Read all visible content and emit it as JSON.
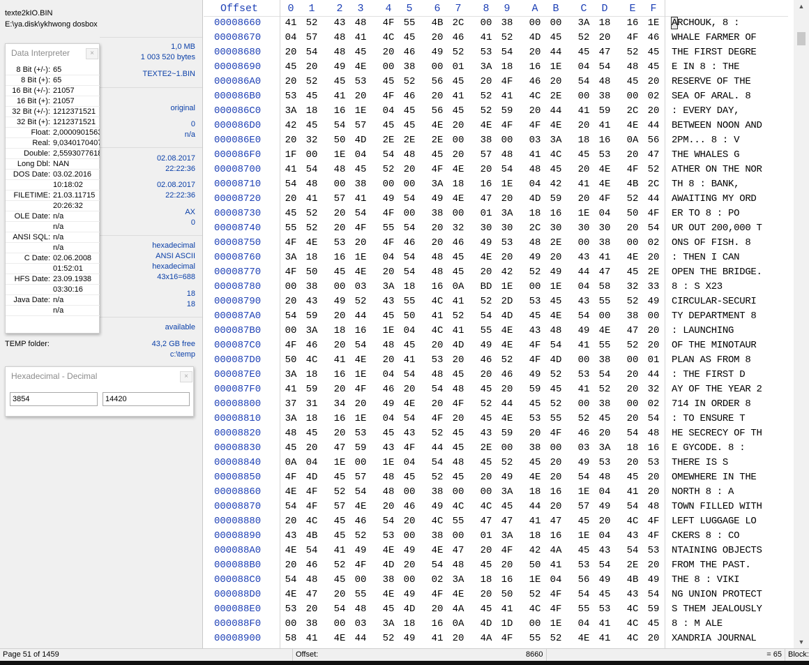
{
  "left_panel": {
    "file_name": "texte2kIO.BIN",
    "file_path": "E:\\ya.disk\\ykhwong dosbox",
    "file_size": "1,0 MB",
    "file_bytes": "1 003 520 bytes",
    "short_name": "TEXTE2~1.BIN",
    "mode": "original",
    "val_zero": "0",
    "val_na": "n/a",
    "created_date": "02.08.2017",
    "created_time": "22:22:36",
    "modified_date": "02.08.2017",
    "modified_time": "22:22:36",
    "attributes": "AX",
    "attr_zero": "0",
    "offset_base": "hexadecimal",
    "charset": "ANSI ASCII",
    "offset_mode": "hexadecimal",
    "bytes_per_row": "43x16=688",
    "val_18a": "18",
    "val_18b": "18",
    "undo": "available",
    "temp_label": "TEMP folder:",
    "temp_free": "43,2 GB free",
    "temp_path": "c:\\temp"
  },
  "data_interpreter": {
    "title": "Data Interpreter",
    "close": "×",
    "rows": [
      {
        "label": "8 Bit (+/-):",
        "value": "65"
      },
      {
        "label": "8 Bit (+):",
        "value": "65"
      },
      {
        "label": "16 Bit (+/-):",
        "value": "21057"
      },
      {
        "label": "16 Bit (+):",
        "value": "21057"
      },
      {
        "label": "32 Bit (+/-):",
        "value": "1212371521"
      },
      {
        "label": "32 Bit (+):",
        "value": "1212371521"
      },
      {
        "label": "Float:",
        "value": "2,0000901563"
      },
      {
        "label": "Real:",
        "value": "9,0340170407"
      },
      {
        "label": "Double:",
        "value": "2,5593077618"
      },
      {
        "label": "Long Dbl:",
        "value": "NAN"
      },
      {
        "label": "DOS Date:",
        "value": "03.02.2016"
      },
      {
        "label": "",
        "value": "10:18:02"
      },
      {
        "label": "FILETIME:",
        "value": "21.03.11715"
      },
      {
        "label": "",
        "value": "20:26:32"
      },
      {
        "label": "OLE Date:",
        "value": "n/a"
      },
      {
        "label": "",
        "value": "n/a"
      },
      {
        "label": "ANSI SQL:",
        "value": "n/a"
      },
      {
        "label": "",
        "value": "n/a"
      },
      {
        "label": "C Date:",
        "value": "02.06.2008"
      },
      {
        "label": "",
        "value": "01:52:01"
      },
      {
        "label": "HFS Date:",
        "value": "23.09.1938"
      },
      {
        "label": "",
        "value": "03:30:16"
      },
      {
        "label": "Java Date:",
        "value": "n/a"
      },
      {
        "label": "",
        "value": "n/a"
      }
    ]
  },
  "hex_decimal": {
    "title": "Hexadecimal - Decimal",
    "close": "×",
    "hex_value": "3854",
    "dec_value": "14420"
  },
  "hex_view": {
    "offset_header": "Offset",
    "column_headers": [
      "0",
      "1",
      "2",
      "3",
      "4",
      "5",
      "6",
      "7",
      "8",
      "9",
      "A",
      "B",
      "C",
      "D",
      "E",
      "F"
    ],
    "rows": [
      {
        "offset": "00008660",
        "bytes": [
          "41",
          "52",
          "43",
          "48",
          "4F",
          "55",
          "4B",
          "2C",
          "00",
          "38",
          "00",
          "00",
          "3A",
          "18",
          "16",
          "1E"
        ],
        "text": "ARCHOUK, 8  :"
      },
      {
        "offset": "00008670",
        "bytes": [
          "04",
          "57",
          "48",
          "41",
          "4C",
          "45",
          "20",
          "46",
          "41",
          "52",
          "4D",
          "45",
          "52",
          "20",
          "4F",
          "46"
        ],
        "text": " WHALE FARMER OF"
      },
      {
        "offset": "00008680",
        "bytes": [
          "20",
          "54",
          "48",
          "45",
          "20",
          "46",
          "49",
          "52",
          "53",
          "54",
          "20",
          "44",
          "45",
          "47",
          "52",
          "45"
        ],
        "text": " THE FIRST DEGRE"
      },
      {
        "offset": "00008690",
        "bytes": [
          "45",
          "20",
          "49",
          "4E",
          "00",
          "38",
          "00",
          "01",
          "3A",
          "18",
          "16",
          "1E",
          "04",
          "54",
          "48",
          "45"
        ],
        "text": "E IN 8  :    THE"
      },
      {
        "offset": "000086A0",
        "bytes": [
          "20",
          "52",
          "45",
          "53",
          "45",
          "52",
          "56",
          "45",
          "20",
          "4F",
          "46",
          "20",
          "54",
          "48",
          "45",
          "20"
        ],
        "text": " RESERVE OF THE "
      },
      {
        "offset": "000086B0",
        "bytes": [
          "53",
          "45",
          "41",
          "20",
          "4F",
          "46",
          "20",
          "41",
          "52",
          "41",
          "4C",
          "2E",
          "00",
          "38",
          "00",
          "02"
        ],
        "text": "SEA OF ARAL. 8"
      },
      {
        "offset": "000086C0",
        "bytes": [
          "3A",
          "18",
          "16",
          "1E",
          "04",
          "45",
          "56",
          "45",
          "52",
          "59",
          "20",
          "44",
          "41",
          "59",
          "2C",
          "20"
        ],
        "text": ":    EVERY DAY, "
      },
      {
        "offset": "000086D0",
        "bytes": [
          "42",
          "45",
          "54",
          "57",
          "45",
          "45",
          "4E",
          "20",
          "4E",
          "4F",
          "4F",
          "4E",
          "20",
          "41",
          "4E",
          "44"
        ],
        "text": "BETWEEN NOON AND"
      },
      {
        "offset": "000086E0",
        "bytes": [
          "20",
          "32",
          "50",
          "4D",
          "2E",
          "2E",
          "2E",
          "00",
          "38",
          "00",
          "03",
          "3A",
          "18",
          "16",
          "0A",
          "56"
        ],
        "text": " 2PM... 8  :   V"
      },
      {
        "offset": "000086F0",
        "bytes": [
          "1F",
          "00",
          "1E",
          "04",
          "54",
          "48",
          "45",
          "20",
          "57",
          "48",
          "41",
          "4C",
          "45",
          "53",
          "20",
          "47"
        ],
        "text": "   THE WHALES G"
      },
      {
        "offset": "00008700",
        "bytes": [
          "41",
          "54",
          "48",
          "45",
          "52",
          "20",
          "4F",
          "4E",
          "20",
          "54",
          "48",
          "45",
          "20",
          "4E",
          "4F",
          "52"
        ],
        "text": "ATHER ON THE NOR"
      },
      {
        "offset": "00008710",
        "bytes": [
          "54",
          "48",
          "00",
          "38",
          "00",
          "00",
          "3A",
          "18",
          "16",
          "1E",
          "04",
          "42",
          "41",
          "4E",
          "4B",
          "2C"
        ],
        "text": "TH 8  :    BANK,"
      },
      {
        "offset": "00008720",
        "bytes": [
          "20",
          "41",
          "57",
          "41",
          "49",
          "54",
          "49",
          "4E",
          "47",
          "20",
          "4D",
          "59",
          "20",
          "4F",
          "52",
          "44"
        ],
        "text": " AWAITING MY ORD"
      },
      {
        "offset": "00008730",
        "bytes": [
          "45",
          "52",
          "20",
          "54",
          "4F",
          "00",
          "38",
          "00",
          "01",
          "3A",
          "18",
          "16",
          "1E",
          "04",
          "50",
          "4F"
        ],
        "text": "ER TO 8  :    PO"
      },
      {
        "offset": "00008740",
        "bytes": [
          "55",
          "52",
          "20",
          "4F",
          "55",
          "54",
          "20",
          "32",
          "30",
          "30",
          "2C",
          "30",
          "30",
          "30",
          "20",
          "54"
        ],
        "text": "UR OUT 200,000 T"
      },
      {
        "offset": "00008750",
        "bytes": [
          "4F",
          "4E",
          "53",
          "20",
          "4F",
          "46",
          "20",
          "46",
          "49",
          "53",
          "48",
          "2E",
          "00",
          "38",
          "00",
          "02"
        ],
        "text": "ONS OF FISH. 8"
      },
      {
        "offset": "00008760",
        "bytes": [
          "3A",
          "18",
          "16",
          "1E",
          "04",
          "54",
          "48",
          "45",
          "4E",
          "20",
          "49",
          "20",
          "43",
          "41",
          "4E",
          "20"
        ],
        "text": ":    THEN I CAN "
      },
      {
        "offset": "00008770",
        "bytes": [
          "4F",
          "50",
          "45",
          "4E",
          "20",
          "54",
          "48",
          "45",
          "20",
          "42",
          "52",
          "49",
          "44",
          "47",
          "45",
          "2E"
        ],
        "text": "OPEN THE BRIDGE."
      },
      {
        "offset": "00008780",
        "bytes": [
          "00",
          "38",
          "00",
          "03",
          "3A",
          "18",
          "16",
          "0A",
          "BD",
          "1E",
          "00",
          "1E",
          "04",
          "58",
          "32",
          "33"
        ],
        "text": " 8  :   S    X23"
      },
      {
        "offset": "00008790",
        "bytes": [
          "20",
          "43",
          "49",
          "52",
          "43",
          "55",
          "4C",
          "41",
          "52",
          "2D",
          "53",
          "45",
          "43",
          "55",
          "52",
          "49"
        ],
        "text": " CIRCULAR-SECURI"
      },
      {
        "offset": "000087A0",
        "bytes": [
          "54",
          "59",
          "20",
          "44",
          "45",
          "50",
          "41",
          "52",
          "54",
          "4D",
          "45",
          "4E",
          "54",
          "00",
          "38",
          "00"
        ],
        "text": "TY DEPARTMENT 8"
      },
      {
        "offset": "000087B0",
        "bytes": [
          "00",
          "3A",
          "18",
          "16",
          "1E",
          "04",
          "4C",
          "41",
          "55",
          "4E",
          "43",
          "48",
          "49",
          "4E",
          "47",
          "20"
        ],
        "text": " :    LAUNCHING "
      },
      {
        "offset": "000087C0",
        "bytes": [
          "4F",
          "46",
          "20",
          "54",
          "48",
          "45",
          "20",
          "4D",
          "49",
          "4E",
          "4F",
          "54",
          "41",
          "55",
          "52",
          "20"
        ],
        "text": "OF THE MINOTAUR "
      },
      {
        "offset": "000087D0",
        "bytes": [
          "50",
          "4C",
          "41",
          "4E",
          "20",
          "41",
          "53",
          "20",
          "46",
          "52",
          "4F",
          "4D",
          "00",
          "38",
          "00",
          "01"
        ],
        "text": "PLAN AS FROM 8"
      },
      {
        "offset": "000087E0",
        "bytes": [
          "3A",
          "18",
          "16",
          "1E",
          "04",
          "54",
          "48",
          "45",
          "20",
          "46",
          "49",
          "52",
          "53",
          "54",
          "20",
          "44"
        ],
        "text": ":    THE FIRST D"
      },
      {
        "offset": "000087F0",
        "bytes": [
          "41",
          "59",
          "20",
          "4F",
          "46",
          "20",
          "54",
          "48",
          "45",
          "20",
          "59",
          "45",
          "41",
          "52",
          "20",
          "32"
        ],
        "text": "AY OF THE YEAR 2"
      },
      {
        "offset": "00008800",
        "bytes": [
          "37",
          "31",
          "34",
          "20",
          "49",
          "4E",
          "20",
          "4F",
          "52",
          "44",
          "45",
          "52",
          "00",
          "38",
          "00",
          "02"
        ],
        "text": "714 IN ORDER 8"
      },
      {
        "offset": "00008810",
        "bytes": [
          "3A",
          "18",
          "16",
          "1E",
          "04",
          "54",
          "4F",
          "20",
          "45",
          "4E",
          "53",
          "55",
          "52",
          "45",
          "20",
          "54"
        ],
        "text": ":    TO ENSURE T"
      },
      {
        "offset": "00008820",
        "bytes": [
          "48",
          "45",
          "20",
          "53",
          "45",
          "43",
          "52",
          "45",
          "43",
          "59",
          "20",
          "4F",
          "46",
          "20",
          "54",
          "48"
        ],
        "text": "HE SECRECY OF TH"
      },
      {
        "offset": "00008830",
        "bytes": [
          "45",
          "20",
          "47",
          "59",
          "43",
          "4F",
          "44",
          "45",
          "2E",
          "00",
          "38",
          "00",
          "03",
          "3A",
          "18",
          "16"
        ],
        "text": "E GYCODE. 8  :"
      },
      {
        "offset": "00008840",
        "bytes": [
          "0A",
          "04",
          "1E",
          "00",
          "1E",
          "04",
          "54",
          "48",
          "45",
          "52",
          "45",
          "20",
          "49",
          "53",
          "20",
          "53"
        ],
        "text": "      THERE IS S"
      },
      {
        "offset": "00008850",
        "bytes": [
          "4F",
          "4D",
          "45",
          "57",
          "48",
          "45",
          "52",
          "45",
          "20",
          "49",
          "4E",
          "20",
          "54",
          "48",
          "45",
          "20"
        ],
        "text": "OMEWHERE IN THE "
      },
      {
        "offset": "00008860",
        "bytes": [
          "4E",
          "4F",
          "52",
          "54",
          "48",
          "00",
          "38",
          "00",
          "00",
          "3A",
          "18",
          "16",
          "1E",
          "04",
          "41",
          "20"
        ],
        "text": "NORTH 8  :    A "
      },
      {
        "offset": "00008870",
        "bytes": [
          "54",
          "4F",
          "57",
          "4E",
          "20",
          "46",
          "49",
          "4C",
          "4C",
          "45",
          "44",
          "20",
          "57",
          "49",
          "54",
          "48"
        ],
        "text": "TOWN FILLED WITH"
      },
      {
        "offset": "00008880",
        "bytes": [
          "20",
          "4C",
          "45",
          "46",
          "54",
          "20",
          "4C",
          "55",
          "47",
          "47",
          "41",
          "47",
          "45",
          "20",
          "4C",
          "4F"
        ],
        "text": " LEFT LUGGAGE LO"
      },
      {
        "offset": "00008890",
        "bytes": [
          "43",
          "4B",
          "45",
          "52",
          "53",
          "00",
          "38",
          "00",
          "01",
          "3A",
          "18",
          "16",
          "1E",
          "04",
          "43",
          "4F"
        ],
        "text": "CKERS 8  :    CO"
      },
      {
        "offset": "000088A0",
        "bytes": [
          "4E",
          "54",
          "41",
          "49",
          "4E",
          "49",
          "4E",
          "47",
          "20",
          "4F",
          "42",
          "4A",
          "45",
          "43",
          "54",
          "53"
        ],
        "text": "NTAINING OBJECTS"
      },
      {
        "offset": "000088B0",
        "bytes": [
          "20",
          "46",
          "52",
          "4F",
          "4D",
          "20",
          "54",
          "48",
          "45",
          "20",
          "50",
          "41",
          "53",
          "54",
          "2E",
          "20"
        ],
        "text": " FROM THE PAST. "
      },
      {
        "offset": "000088C0",
        "bytes": [
          "54",
          "48",
          "45",
          "00",
          "38",
          "00",
          "02",
          "3A",
          "18",
          "16",
          "1E",
          "04",
          "56",
          "49",
          "4B",
          "49"
        ],
        "text": "THE 8  :    VIKI"
      },
      {
        "offset": "000088D0",
        "bytes": [
          "4E",
          "47",
          "20",
          "55",
          "4E",
          "49",
          "4F",
          "4E",
          "20",
          "50",
          "52",
          "4F",
          "54",
          "45",
          "43",
          "54"
        ],
        "text": "NG UNION PROTECT"
      },
      {
        "offset": "000088E0",
        "bytes": [
          "53",
          "20",
          "54",
          "48",
          "45",
          "4D",
          "20",
          "4A",
          "45",
          "41",
          "4C",
          "4F",
          "55",
          "53",
          "4C",
          "59"
        ],
        "text": "S THEM JEALOUSLY"
      },
      {
        "offset": "000088F0",
        "bytes": [
          "00",
          "38",
          "00",
          "03",
          "3A",
          "18",
          "16",
          "0A",
          "4D",
          "1D",
          "00",
          "1E",
          "04",
          "41",
          "4C",
          "45"
        ],
        "text": " 8  :  M    ALE"
      },
      {
        "offset": "00008900",
        "bytes": [
          "58",
          "41",
          "4E",
          "44",
          "52",
          "49",
          "41",
          "20",
          "4A",
          "4F",
          "55",
          "52",
          "4E",
          "41",
          "4C",
          "20"
        ],
        "text": "XANDRIA JOURNAL "
      }
    ]
  },
  "scrollbar": {
    "up_icon": "▲",
    "down_icon": "▼"
  },
  "statusbar": {
    "page": "Page 51 of 1459",
    "offset_label": "Offset:",
    "offset_value": "8660",
    "value": "= 65",
    "block_label": "Block:"
  }
}
